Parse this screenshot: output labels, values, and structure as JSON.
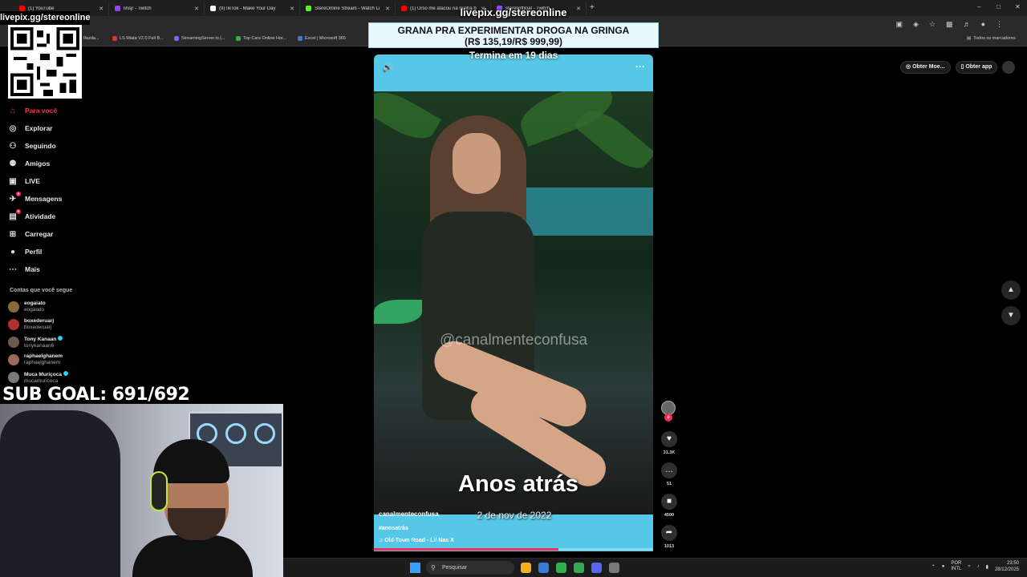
{
  "browser": {
    "tabs": [
      {
        "label": "(1) YouTube",
        "color": "#ff0000"
      },
      {
        "label": "linsjr - Twitch",
        "color": "#9146ff"
      },
      {
        "label": "(9)TikTok - Make Your Day",
        "color": "#ffffff"
      },
      {
        "label": "StereOnline Stream - Watch Li",
        "color": "#53fc18"
      },
      {
        "label": "(1) Urso me atacou na minha b",
        "color": "#ff0000"
      },
      {
        "label": "stereliofficial - Twitch",
        "color": "#9146ff"
      }
    ],
    "new_tab": "+",
    "window_controls": [
      "–",
      "□",
      "✕"
    ],
    "bookmarks": [
      {
        "label": "LS Miata V2.0 Full B...",
        "color": "#e03030"
      },
      {
        "label": "StreamingServer.io |...",
        "color": "#6a6aff"
      },
      {
        "label": "Top Cars Online Hor...",
        "color": "#2db34a"
      },
      {
        "label": "Excel | Microsoft 365",
        "color": "#3a7bd5"
      }
    ],
    "bookmark_fragment": "Ifazda...",
    "all_bookmarks": "Todos os marcadores"
  },
  "overlay": {
    "qr_label": "livepix.gg/stereonline",
    "top_link": "livepix.gg/stereonline",
    "banner_line1": "GRANA PRA EXPERIMENTAR DROGA NA GRINGA",
    "banner_line2": "(R$ 135,19/R$ 999,99)",
    "countdown": "Termina em 19 dias",
    "sub_goal": "SUB GOAL: 691/692"
  },
  "sidebar": {
    "nav": [
      {
        "label": "Para você",
        "icon": "home-icon",
        "glyph": "⌂",
        "active": true
      },
      {
        "label": "Explorar",
        "icon": "compass-icon",
        "glyph": "◎"
      },
      {
        "label": "Seguindo",
        "icon": "following-icon",
        "glyph": "⚇"
      },
      {
        "label": "Amigos",
        "icon": "friends-icon",
        "glyph": "⚉"
      },
      {
        "label": "LIVE",
        "icon": "live-icon",
        "glyph": "▣"
      },
      {
        "label": "Mensagens",
        "icon": "messages-icon",
        "glyph": "✈",
        "badge": "9"
      },
      {
        "label": "Atividade",
        "icon": "activity-icon",
        "glyph": "▤",
        "badge": "9"
      },
      {
        "label": "Carregar",
        "icon": "upload-icon",
        "glyph": "⊞"
      },
      {
        "label": "Perfil",
        "icon": "profile-icon",
        "glyph": "●"
      },
      {
        "label": "Mais",
        "icon": "more-icon",
        "glyph": "⋯"
      }
    ],
    "following_heading": "Contas que você segue",
    "following": [
      {
        "name": "eogaiato",
        "handle": "eogaiato",
        "verified": false,
        "avatar_color": "#8a6a3a"
      },
      {
        "name": "boxederuarj",
        "handle": "boxederuarj",
        "verified": false,
        "avatar_color": "#b03030"
      },
      {
        "name": "Tony Kanaan",
        "handle": "tonykanaan6",
        "verified": true,
        "avatar_color": "#6a5a4a"
      },
      {
        "name": "raphaelghanem",
        "handle": "raphaelghanem",
        "verified": false,
        "avatar_color": "#9a6a5a"
      },
      {
        "name": "Muca Muriçoca",
        "handle": "mucamuricoca",
        "verified": true,
        "avatar_color": "#7a7a7a"
      }
    ]
  },
  "video": {
    "watermark": "@canalmenteconfusa",
    "overlay_title": "Anos atrás",
    "overlay_date": "2 de nov de 2022",
    "author": "canalmenteconfusa",
    "hashtag": "#anosatrás",
    "music": "♫  Old Town Road - Lil Nas X",
    "volume_icon": "🔊",
    "more_icon": "···",
    "progress": 0.66
  },
  "actions": [
    {
      "name": "like",
      "glyph": "♥",
      "count": "31.3K"
    },
    {
      "name": "comment",
      "glyph": "…",
      "count": "51"
    },
    {
      "name": "bookmark",
      "glyph": "■",
      "count": "4500"
    },
    {
      "name": "share",
      "glyph": "➦",
      "count": "1013"
    }
  ],
  "tiktok_top": {
    "coins": "Obter Moe...",
    "app": "Obter app"
  },
  "taskbar": {
    "search": "Pesquisar",
    "lang_top": "POR",
    "lang_bottom": "INTL",
    "time": "23:50",
    "date": "28/12/2025",
    "apps": [
      "#f2b01e",
      "#3a7bd5",
      "#2db34a",
      "#34a853",
      "#5865f2",
      "#7a7a7a"
    ]
  }
}
